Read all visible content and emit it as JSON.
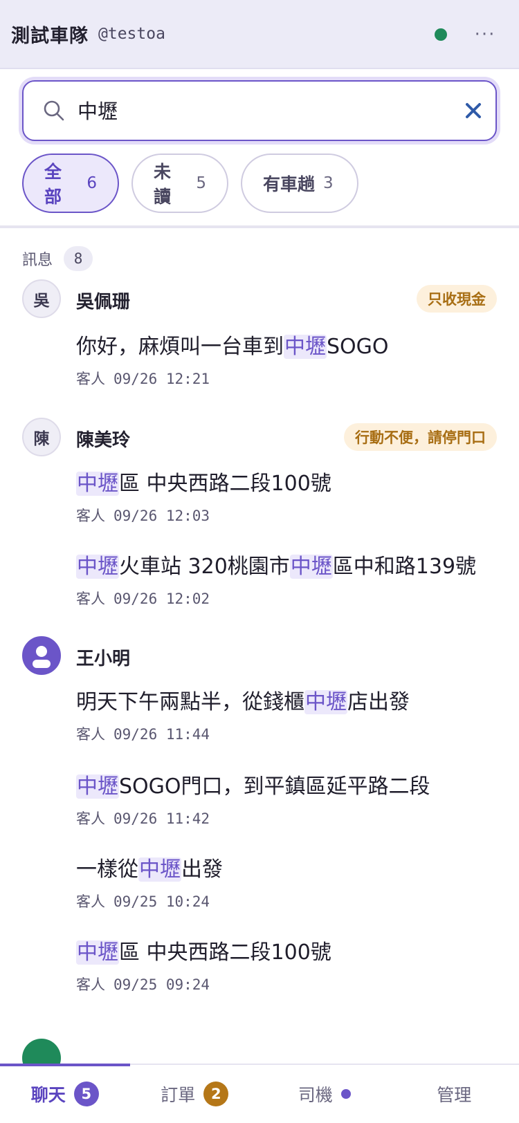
{
  "header": {
    "title": "測試車隊",
    "handle": "@testoa",
    "more_label": "···",
    "status_color": "#1f8a5a"
  },
  "search": {
    "value": "中壢",
    "placeholder": ""
  },
  "filters": [
    {
      "label": "全部",
      "count": "6",
      "active": true
    },
    {
      "label": "未讀",
      "count": "5",
      "active": false
    },
    {
      "label": "有車趟",
      "count": "3",
      "active": false
    }
  ],
  "section": {
    "label": "訊息",
    "count": "8"
  },
  "groups": [
    {
      "avatar": "吳",
      "name": "吳佩珊",
      "tag": "只收現金",
      "messages": [
        {
          "parts": [
            {
              "t": "你好，麻煩叫一台車到"
            },
            {
              "t": "中壢",
              "hl": true
            },
            {
              "t": "SOGO"
            }
          ],
          "sender": "客人",
          "time": "09/26 12:21"
        }
      ]
    },
    {
      "avatar": "陳",
      "name": "陳美玲",
      "tag": "行動不便，請停門口",
      "messages": [
        {
          "parts": [
            {
              "t": "中壢",
              "hl": true
            },
            {
              "t": "區 中央西路二段100號"
            }
          ],
          "sender": "客人",
          "time": "09/26 12:03"
        },
        {
          "parts": [
            {
              "t": "中壢",
              "hl": true
            },
            {
              "t": "火車站 320桃園市"
            },
            {
              "t": "中壢",
              "hl": true
            },
            {
              "t": "區中和路139號"
            }
          ],
          "sender": "客人",
          "time": "09/26 12:02"
        }
      ]
    },
    {
      "avatar": "",
      "name": "王小明",
      "tag": "",
      "messages": [
        {
          "parts": [
            {
              "t": "明天下午兩點半，從錢櫃"
            },
            {
              "t": "中壢",
              "hl": true
            },
            {
              "t": "店出發"
            }
          ],
          "sender": "客人",
          "time": "09/26 11:44"
        },
        {
          "parts": [
            {
              "t": "中壢",
              "hl": true
            },
            {
              "t": "SOGO門口，到平鎮區延平路二段"
            }
          ],
          "sender": "客人",
          "time": "09/26 11:42"
        },
        {
          "parts": [
            {
              "t": "一樣從"
            },
            {
              "t": "中壢",
              "hl": true
            },
            {
              "t": "出發"
            }
          ],
          "sender": "客人",
          "time": "09/25 10:24"
        },
        {
          "parts": [
            {
              "t": "中壢",
              "hl": true
            },
            {
              "t": "區 中央西路二段100號"
            }
          ],
          "sender": "客人",
          "time": "09/25 09:24"
        }
      ]
    }
  ],
  "tabs": [
    {
      "label": "聊天",
      "badge": "5",
      "badge_style": "purple",
      "active": true
    },
    {
      "label": "訂單",
      "badge": "2",
      "badge_style": "amber",
      "active": false
    },
    {
      "label": "司機",
      "badge": "",
      "badge_style": "dot",
      "active": false
    },
    {
      "label": "管理",
      "badge": "",
      "badge_style": "",
      "active": false
    }
  ],
  "colors": {
    "accent": "#6b55c8",
    "highlight_bg": "#ece8fb",
    "tag_bg": "#fdf0dc",
    "tag_text": "#a86e14",
    "online": "#1f8a5a",
    "order_badge": "#b57718"
  }
}
